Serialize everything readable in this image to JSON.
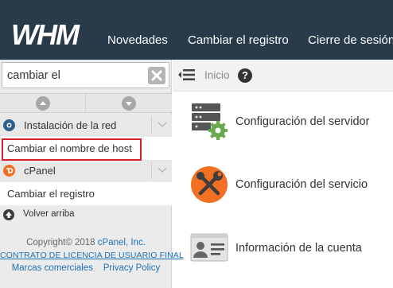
{
  "header": {
    "logo": "WHM",
    "nav": [
      "Novedades",
      "Cambiar el registro",
      "Cierre de sesión"
    ]
  },
  "sidebar": {
    "search_value": "cambiar el",
    "search_placeholder": "",
    "clear_icon": "x-icon",
    "categories": [
      {
        "label": "Instalación de la red",
        "icon": "network-icon",
        "color": "#2d5f8b"
      },
      {
        "label": "cPanel",
        "icon": "cpanel-icon",
        "color": "#f36f21"
      }
    ],
    "links": [
      "Cambiar el nombre de host",
      "Cambiar el registro"
    ],
    "back_to_top": "Volver arriba",
    "footer": {
      "copyright": "Copyright© 2018",
      "brand": "cPanel, Inc.",
      "license": "CONTRATO DE LICENCIA DE USUARIO FINAL",
      "trademarks": "Marcas comerciales",
      "privacy": "Privacy Policy"
    }
  },
  "main": {
    "breadcrumb": "Inicio",
    "items": [
      {
        "label": "Configuración del servidor",
        "icon": "server-gear-icon"
      },
      {
        "label": "Configuración del servicio",
        "icon": "wrench-icon"
      },
      {
        "label": "Información de la cuenta",
        "icon": "account-card-icon"
      }
    ]
  },
  "colors": {
    "topbar": "#293a4a",
    "link_blue": "#1e72b8",
    "highlight_red": "#d2232a",
    "cpanel_orange": "#f36f21",
    "gear_green": "#6aa84f"
  }
}
